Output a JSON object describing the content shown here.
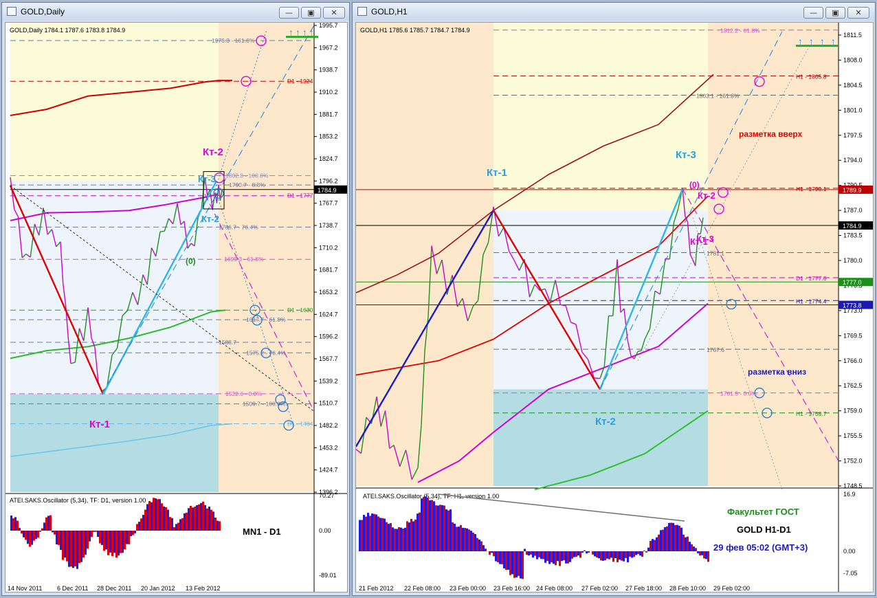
{
  "left_window": {
    "title": "GOLD,Daily",
    "btn_min": "—",
    "btn_max": "▣",
    "btn_close": "✕"
  },
  "right_window": {
    "title": "GOLD,H1",
    "btn_min": "—",
    "btn_max": "▣",
    "btn_close": "✕"
  },
  "chart_data": [
    {
      "type": "line",
      "symbol_header": "GOLD,Daily  1784.1 1787.6 1783.8 1784.9",
      "y_ticks": [
        "1995.7",
        "1967.2",
        "1938.7",
        "1910.2",
        "1881.7",
        "1853.2",
        "1824.7",
        "1796.2",
        "1767.7",
        "1738.7",
        "1710.2",
        "1681.7",
        "1653.2",
        "1624.7",
        "1596.2",
        "1567.7",
        "1539.2",
        "1510.7",
        "1482.2",
        "1453.2",
        "1424.7",
        "1396.2"
      ],
      "y_range": [
        1396.2,
        1995.7
      ],
      "current_price": "1784.9",
      "x_ticks": [
        "14 Nov 2011",
        "6 Dec 2011",
        "28 Dec 2011",
        "20 Jan 2012",
        "13 Feb 2012"
      ],
      "level_labels": [
        "1976.3 - 161.8%",
        "D1 - 1924",
        "1802.8 - 100.0%",
        "1790.7 - 8.8%",
        "D1 - 1777",
        "1736.7 - 76.4%",
        "1695.3 - 61.8%",
        "D1 - 1630",
        "1617.7 - 61.8%",
        "1588.7",
        "1575.2 - 76.4%",
        "1522.6 - 0.0%",
        "1509.7 - 100.0%",
        "D1 - 1484"
      ],
      "annotations": [
        "Кт-2",
        "Кт-3",
        "Кт-2",
        "(0)",
        "Кт-1"
      ],
      "series": [
        {
          "name": "",
          "approx": [
            [
              0,
              1880
            ],
            [
              50,
              1890
            ],
            [
              100,
              1910
            ],
            [
              150,
              1912
            ],
            [
              200,
              1918
            ],
            [
              220,
              1925
            ],
            [
              260,
              1925
            ]
          ]
        },
        {
          "name": "",
          "approx": [
            [
              0,
              1745
            ],
            [
              60,
              1755
            ],
            [
              120,
              1755
            ],
            [
              200,
              1760
            ],
            [
              260,
              1780
            ]
          ]
        },
        {
          "name": "",
          "approx": [
            [
              0,
              1568
            ],
            [
              60,
              1580
            ],
            [
              130,
              1583
            ],
            [
              200,
              1600
            ],
            [
              260,
              1630
            ]
          ]
        },
        {
          "name": "",
          "approx": [
            [
              0,
              1440
            ],
            [
              60,
              1450
            ],
            [
              130,
              1460
            ],
            [
              200,
              1470
            ],
            [
              260,
              1484
            ]
          ]
        }
      ],
      "zigzag": [
        [
          0,
          1790
        ],
        [
          135,
          1522
        ],
        [
          300,
          1796
        ]
      ],
      "oscillator": {
        "title": "ATEI.SAKS.Oscillator (5,34), TF: D1,  version 1.00",
        "ticks": [
          "70.27",
          "0.00",
          "-89.01"
        ],
        "note": "MN1 - D1"
      }
    },
    {
      "type": "line",
      "symbol_header": "GOLD,H1  1785.6 1785.7 1784.7 1784.9",
      "y_ticks": [
        "1811.5",
        "1808.0",
        "1804.5",
        "1801.0",
        "1797.5",
        "1794.0",
        "1790.5",
        "1787.0",
        "1783.5",
        "1780.0",
        "1776.5",
        "1773.0",
        "1769.5",
        "1766.0",
        "1762.5",
        "1759.0",
        "1755.5",
        "1752.0",
        "1748.5"
      ],
      "y_range": [
        1748.5,
        1811.5
      ],
      "current_price": "1784.9",
      "price_tags": [
        "1789.9",
        "1777.0",
        "1773.8"
      ],
      "x_ticks": [
        "21 Feb 2012",
        "22 Feb 08:00",
        "23 Feb 00:00",
        "23 Feb 16:00",
        "24 Feb 08:00",
        "27 Feb 02:00",
        "27 Feb 18:00",
        "28 Feb 10:00",
        "29 Feb 02:00"
      ],
      "level_labels": [
        "1812.2 - 61.8%",
        "H1 - 1805.8",
        "1803.1 - 161.8%",
        "H1 - 1790.1",
        "1781.1",
        "D1 - 1777.6",
        "H1 - 1774.4",
        "1767.6",
        "1761.5 - 0.0%",
        "H1 - 1758.7"
      ],
      "annotations": [
        "Кт-1",
        "Кт-3",
        "(0)",
        "Кт-2",
        "Кт-1",
        "Кт-3",
        "Кт-2",
        "разметка вверх",
        "разметка вниз"
      ],
      "zigzag": [
        [
          0,
          1754
        ],
        [
          200,
          1787
        ],
        [
          355,
          1762
        ],
        [
          475,
          1790
        ]
      ],
      "oscillator": {
        "title": "ATEI.SAKS.Oscillator (5,34), TF: H1,  version 1.00",
        "ticks": [
          "16.9",
          "0.00",
          "-7.05"
        ]
      },
      "info_text": [
        "Факультет ГОСТ",
        "GOLD    H1-D1",
        "29 фев 05:02 (GMT+3)"
      ]
    }
  ]
}
